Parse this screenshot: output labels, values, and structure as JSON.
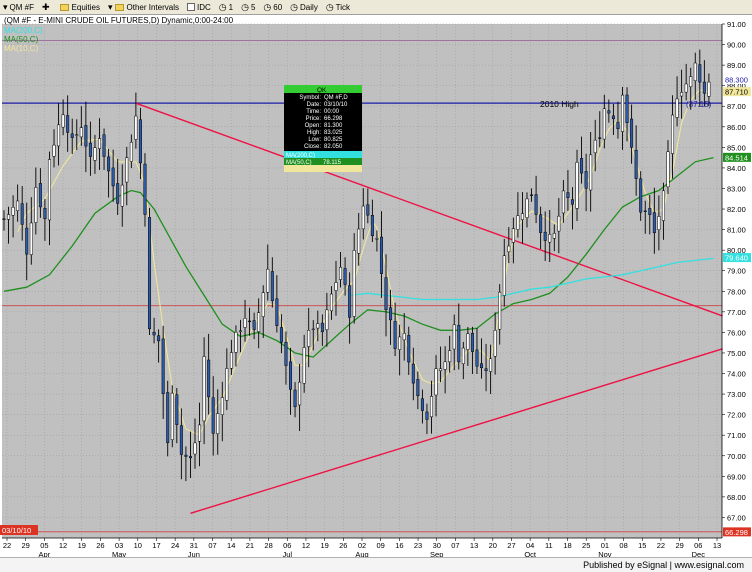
{
  "toolbar": {
    "symbol": "QM #F",
    "equities": "Equities",
    "other_intervals": "Other Intervals",
    "idc": "IDC",
    "i1": "1",
    "i5": "5",
    "i60": "60",
    "daily": "Daily",
    "tick": "Tick"
  },
  "chart_header": {
    "title": "(QM #F - E-MINI CRUDE OIL FUTURES,D) Dynamic,0:00-24:00",
    "ma_labels": [
      "MA(200,C)",
      "MA(50,C)",
      "MA(10,C)"
    ]
  },
  "annotations": {
    "high_2010_label": "2010 High",
    "high_2010_value": "(87.15)"
  },
  "cursor_window": {
    "title": "QK",
    "rows": [
      [
        "Symbol",
        "QM #F,D"
      ],
      [
        "Date",
        "03/10/10"
      ],
      [
        "Time",
        "00:00"
      ],
      [
        "Price",
        "66.298"
      ],
      [
        "Open",
        "81.300"
      ],
      [
        "High",
        "83.025"
      ],
      [
        "Low",
        "80.825"
      ],
      [
        "Close",
        "82.050"
      ]
    ],
    "ma200": "MA(200,C)",
    "ma50": "MA(50,C)",
    "ma50_value": "78.115"
  },
  "price_tags": {
    "last": "88.300",
    "ma10": "87.710",
    "ma50": "84.514",
    "ma200": "79.640",
    "cursor": "66.298"
  },
  "cursor_date_tag": "03/10/10",
  "colors": {
    "chart_bg": "#c0c0c0",
    "bar": "#000000",
    "bar_fill": "#2d5aa6",
    "ma10": "#f0e69c",
    "ma50": "#1f8f1f",
    "ma200": "#33e0e0",
    "trendline": "#ee1144",
    "support_line": "#cc4444",
    "high_line": "#1c1ca8",
    "top_line": "#9a6a9a"
  },
  "footer": {
    "text": "Published by eSignal | www.esignal.com"
  },
  "chart_data": {
    "type": "bar",
    "title": "(QM #F - E-MINI CRUDE OIL FUTURES,D) Dynamic,0:00-24:00",
    "y_axis": {
      "min": 66,
      "max": 91,
      "ticks": [
        67,
        68,
        69,
        70,
        71,
        72,
        73,
        74,
        75,
        76,
        77,
        78,
        79,
        80,
        81,
        82,
        83,
        84,
        85,
        86,
        87,
        88,
        89,
        90,
        91
      ]
    },
    "x_day_ticks": [
      "22",
      "29",
      "05",
      "12",
      "19",
      "26",
      "03",
      "10",
      "17",
      "24",
      "31",
      "07",
      "14",
      "21",
      "28",
      "06",
      "12",
      "19",
      "26",
      "02",
      "09",
      "16",
      "23",
      "30",
      "07",
      "13",
      "20",
      "27",
      "04",
      "11",
      "18",
      "25",
      "01",
      "08",
      "15",
      "22",
      "29",
      "06",
      "13"
    ],
    "x_months": [
      "Apr",
      "May",
      "Jun",
      "Jul",
      "Aug",
      "Sep",
      "Oct",
      "Nov",
      "Dec"
    ],
    "close_path": [
      [
        0,
        81.5
      ],
      [
        3,
        82.3
      ],
      [
        5,
        80.0
      ],
      [
        7,
        83.1
      ],
      [
        9,
        81.5
      ],
      [
        10,
        84.5
      ],
      [
        13,
        86.8
      ],
      [
        15,
        85.2
      ],
      [
        17,
        86.1
      ],
      [
        19,
        84.3
      ],
      [
        21,
        85.6
      ],
      [
        23,
        83.8
      ],
      [
        25,
        82.5
      ],
      [
        27,
        84.4
      ],
      [
        29,
        86.5
      ],
      [
        31,
        82.0
      ],
      [
        32,
        76.0
      ],
      [
        34,
        75.6
      ],
      [
        36,
        70.5
      ],
      [
        37,
        73.3
      ],
      [
        39,
        70.1
      ],
      [
        41,
        69.8
      ],
      [
        43,
        71.5
      ],
      [
        44,
        74.8
      ],
      [
        46,
        71.0
      ],
      [
        50,
        75.2
      ],
      [
        53,
        76.8
      ],
      [
        55,
        75.9
      ],
      [
        58,
        79.1
      ],
      [
        59,
        77.6
      ],
      [
        61,
        75.5
      ],
      [
        63,
        73.0
      ],
      [
        64,
        72.2
      ],
      [
        66,
        75.4
      ],
      [
        68,
        76.3
      ],
      [
        70,
        76.0
      ],
      [
        72,
        77.8
      ],
      [
        74,
        79.2
      ],
      [
        76,
        77.0
      ],
      [
        77,
        79.8
      ],
      [
        79,
        82.3
      ],
      [
        81,
        81.0
      ],
      [
        82,
        80.5
      ],
      [
        84,
        77.3
      ],
      [
        86,
        75.5
      ],
      [
        88,
        75.9
      ],
      [
        90,
        73.8
      ],
      [
        91,
        72.9
      ],
      [
        93,
        72.0
      ],
      [
        95,
        74.0
      ],
      [
        97,
        74.5
      ],
      [
        99,
        76.2
      ],
      [
        100,
        74.8
      ],
      [
        102,
        75.8
      ],
      [
        104,
        74.4
      ],
      [
        105,
        74.0
      ],
      [
        107,
        74.5
      ],
      [
        108,
        76.3
      ],
      [
        110,
        79.8
      ],
      [
        112,
        81.2
      ],
      [
        114,
        82.0
      ],
      [
        116,
        82.8
      ],
      [
        118,
        81.0
      ],
      [
        120,
        80.5
      ],
      [
        121,
        80.7
      ],
      [
        123,
        82.6
      ],
      [
        125,
        82.3
      ],
      [
        126,
        84.0
      ],
      [
        128,
        83.1
      ],
      [
        129,
        84.6
      ],
      [
        131,
        85.7
      ],
      [
        132,
        86.9
      ],
      [
        134,
        86.6
      ],
      [
        135,
        86.0
      ],
      [
        136,
        87.8
      ],
      [
        138,
        84.8
      ],
      [
        139,
        83.4
      ],
      [
        140,
        82.0
      ],
      [
        142,
        81.6
      ],
      [
        143,
        80.8
      ],
      [
        145,
        82.6
      ],
      [
        146,
        84.5
      ],
      [
        147,
        86.4
      ],
      [
        148,
        87.6
      ],
      [
        149,
        87.9
      ],
      [
        151,
        88.3
      ],
      [
        152,
        89.0
      ],
      [
        153,
        88.4
      ],
      [
        154,
        87.6
      ],
      [
        155,
        88.3
      ]
    ],
    "ma_series": [
      {
        "name": "MA(10,C)",
        "values": [
          [
            3,
            80.9
          ],
          [
            5,
            81.8
          ],
          [
            9,
            82.5
          ],
          [
            13,
            84.1
          ],
          [
            17,
            85.3
          ],
          [
            21,
            85.4
          ],
          [
            25,
            84.3
          ],
          [
            29,
            84.3
          ],
          [
            31,
            83.2
          ],
          [
            33,
            79.4
          ],
          [
            35,
            76.2
          ],
          [
            37,
            73.3
          ],
          [
            40,
            71.3
          ],
          [
            43,
            71.0
          ],
          [
            45,
            71.9
          ],
          [
            48,
            72.8
          ],
          [
            51,
            74.4
          ],
          [
            55,
            76.4
          ],
          [
            58,
            77.4
          ],
          [
            60,
            77.3
          ],
          [
            62,
            75.9
          ],
          [
            64,
            74.4
          ],
          [
            66,
            74.4
          ],
          [
            69,
            75.9
          ],
          [
            72,
            77.2
          ],
          [
            75,
            78.1
          ],
          [
            77,
            78.5
          ],
          [
            79,
            80.1
          ],
          [
            81,
            81.4
          ],
          [
            82,
            81.1
          ],
          [
            84,
            79.2
          ],
          [
            86,
            77.0
          ],
          [
            89,
            75.1
          ],
          [
            92,
            73.7
          ],
          [
            94,
            73.5
          ],
          [
            96,
            73.6
          ],
          [
            99,
            74.4
          ],
          [
            102,
            75.1
          ],
          [
            105,
            75.1
          ],
          [
            107,
            74.6
          ],
          [
            109,
            77.1
          ],
          [
            111,
            79.7
          ],
          [
            113,
            81.2
          ],
          [
            116,
            81.9
          ],
          [
            119,
            81.6
          ],
          [
            122,
            81.2
          ],
          [
            124,
            81.8
          ],
          [
            127,
            82.8
          ],
          [
            129,
            83.6
          ],
          [
            131,
            84.9
          ],
          [
            133,
            85.9
          ],
          [
            135,
            86.3
          ],
          [
            137,
            85.8
          ],
          [
            139,
            84.3
          ],
          [
            141,
            82.8
          ],
          [
            143,
            81.8
          ],
          [
            145,
            82.0
          ],
          [
            147,
            83.8
          ],
          [
            149,
            86.2
          ],
          [
            151,
            87.3
          ],
          [
            153,
            87.8
          ],
          [
            155,
            87.7
          ]
        ]
      },
      {
        "name": "MA(50,C)",
        "values": [
          [
            0,
            78.0
          ],
          [
            5,
            78.2
          ],
          [
            10,
            78.8
          ],
          [
            15,
            80.2
          ],
          [
            20,
            81.8
          ],
          [
            25,
            82.6
          ],
          [
            28,
            82.9
          ],
          [
            30,
            82.8
          ],
          [
            33,
            82.0
          ],
          [
            36,
            80.8
          ],
          [
            40,
            79.2
          ],
          [
            44,
            77.8
          ],
          [
            48,
            76.4
          ],
          [
            52,
            75.8
          ],
          [
            56,
            76.0
          ],
          [
            60,
            75.6
          ],
          [
            64,
            75.0
          ],
          [
            68,
            74.8
          ],
          [
            72,
            75.6
          ],
          [
            76,
            76.4
          ],
          [
            80,
            77.1
          ],
          [
            84,
            77.0
          ],
          [
            88,
            76.8
          ],
          [
            92,
            76.4
          ],
          [
            96,
            76.1
          ],
          [
            100,
            76.1
          ],
          [
            104,
            76.2
          ],
          [
            108,
            76.9
          ],
          [
            112,
            77.4
          ],
          [
            116,
            77.6
          ],
          [
            120,
            77.9
          ],
          [
            124,
            78.7
          ],
          [
            128,
            79.8
          ],
          [
            132,
            81.0
          ],
          [
            136,
            82.1
          ],
          [
            140,
            82.6
          ],
          [
            144,
            82.9
          ],
          [
            148,
            83.6
          ],
          [
            152,
            84.3
          ],
          [
            156,
            84.5
          ]
        ]
      },
      {
        "name": "MA(200,C)",
        "values": [
          [
            76,
            77.8
          ],
          [
            80,
            77.9
          ],
          [
            84,
            77.8
          ],
          [
            88,
            77.7
          ],
          [
            92,
            77.6
          ],
          [
            96,
            77.6
          ],
          [
            100,
            77.6
          ],
          [
            104,
            77.6
          ],
          [
            108,
            77.7
          ],
          [
            112,
            77.9
          ],
          [
            116,
            78.1
          ],
          [
            120,
            78.2
          ],
          [
            124,
            78.4
          ],
          [
            128,
            78.6
          ],
          [
            132,
            78.7
          ],
          [
            136,
            78.8
          ],
          [
            140,
            79.0
          ],
          [
            144,
            79.2
          ],
          [
            148,
            79.4
          ],
          [
            152,
            79.5
          ],
          [
            156,
            79.6
          ]
        ]
      }
    ],
    "horizontal_lines": [
      {
        "price": 87.15,
        "label": "2010 High"
      },
      {
        "price": 90.2
      },
      {
        "price": 77.3
      },
      {
        "price": 66.3
      }
    ],
    "trendlines": [
      {
        "from": [
          29,
          87.15
        ],
        "to": [
          158,
          76.8
        ]
      },
      {
        "from": [
          41,
          67.2
        ],
        "to": [
          158,
          75.2
        ]
      }
    ]
  }
}
